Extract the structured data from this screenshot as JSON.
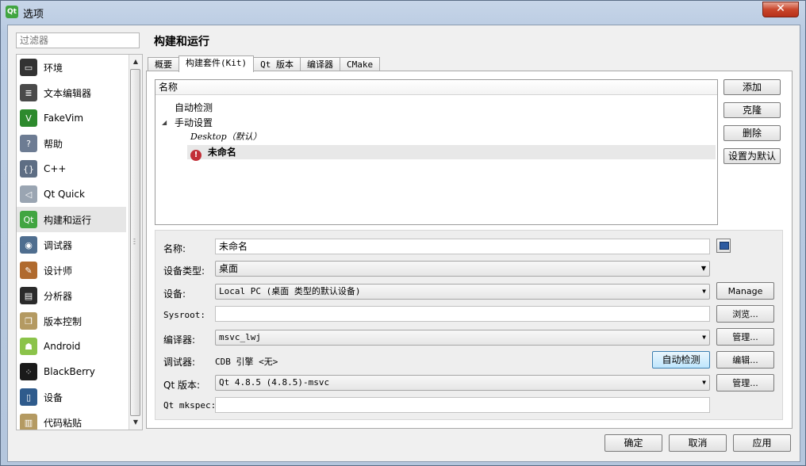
{
  "window": {
    "title": "选项",
    "app_icon": "Qt",
    "close_glyph": "✕"
  },
  "filter": {
    "placeholder": "过滤器"
  },
  "sidebar": {
    "items": [
      {
        "label": "环境",
        "icon": "monitor-icon",
        "color": "#333333",
        "glyph": "▭"
      },
      {
        "label": "文本编辑器",
        "icon": "text-editor-icon",
        "color": "#4a4a4a",
        "glyph": "≣"
      },
      {
        "label": "FakeVim",
        "icon": "fakevim-icon",
        "color": "#2d8a2d",
        "glyph": "V"
      },
      {
        "label": "帮助",
        "icon": "help-icon",
        "color": "#6d7c93",
        "glyph": "?"
      },
      {
        "label": "C++",
        "icon": "cpp-braces-icon",
        "color": "#5e6e84",
        "glyph": "{}"
      },
      {
        "label": "Qt Quick",
        "icon": "paper-plane-icon",
        "color": "#9aa5b2",
        "glyph": "◁"
      },
      {
        "label": "构建和运行",
        "icon": "build-run-icon",
        "color": "#41a541",
        "glyph": "Qt"
      },
      {
        "label": "调试器",
        "icon": "debugger-icon",
        "color": "#4f6e8f",
        "glyph": "◉"
      },
      {
        "label": "设计师",
        "icon": "designer-icon",
        "color": "#b06a2e",
        "glyph": "✎"
      },
      {
        "label": "分析器",
        "icon": "analyzer-icon",
        "color": "#2b2b2b",
        "glyph": "▤"
      },
      {
        "label": "版本控制",
        "icon": "version-control-icon",
        "color": "#b49a62",
        "glyph": "❐"
      },
      {
        "label": "Android",
        "icon": "android-icon",
        "color": "#8bc34a",
        "glyph": "☗"
      },
      {
        "label": "BlackBerry",
        "icon": "blackberry-icon",
        "color": "#1a1a1a",
        "glyph": "⁘"
      },
      {
        "label": "设备",
        "icon": "device-icon",
        "color": "#2f5b8c",
        "glyph": "▯"
      },
      {
        "label": "代码粘贴",
        "icon": "code-paste-icon",
        "color": "#b49a62",
        "glyph": "▥"
      }
    ],
    "active_index": 6,
    "scroll_up": "▲",
    "scroll_down": "▼"
  },
  "page": {
    "title": "构建和运行"
  },
  "tabs": [
    {
      "label": "概要"
    },
    {
      "label": "构建套件(Kit)"
    },
    {
      "label": "Qt 版本"
    },
    {
      "label": "编译器"
    },
    {
      "label": "CMake"
    }
  ],
  "active_tab": 1,
  "kit_tree": {
    "header": "名称",
    "auto_detected": "自动检测",
    "manual_expander": "◢",
    "manual": "手动设置",
    "desktop_kit": "Desktop（默认）",
    "unnamed_kit": "未命名",
    "warning_glyph": "!"
  },
  "kit_buttons": {
    "add": "添加",
    "clone": "克隆",
    "remove": "删除",
    "make_default": "设置为默认"
  },
  "kit_form": {
    "name_label": "名称:",
    "name_value": "未命名",
    "device_type_label": "设备类型:",
    "device_type_value": "桌面",
    "device_label": "设备:",
    "device_value": "Local PC (桌面 类型的默认设备)",
    "device_manage": "Manage",
    "sysroot_label": "Sysroot:",
    "sysroot_value": "",
    "sysroot_browse": "浏览...",
    "compiler_label": "编译器:",
    "compiler_value": "msvc_lwj",
    "compiler_manage": "管理...",
    "debugger_label": "调试器:",
    "debugger_value": "CDB 引擎 <无>",
    "debugger_autodetect": "自动检测",
    "debugger_edit": "编辑...",
    "qt_version_label": "Qt 版本:",
    "qt_version_value": "Qt 4.8.5 (4.8.5)-msvc",
    "qt_version_manage": "管理...",
    "mkspec_label": "Qt mkspec:",
    "mkspec_value": ""
  },
  "dialog_buttons": {
    "ok": "确定",
    "cancel": "取消",
    "apply": "应用"
  }
}
